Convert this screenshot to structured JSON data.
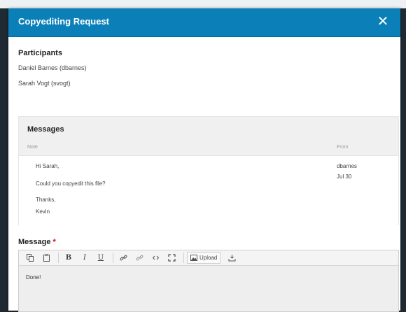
{
  "modal": {
    "title": "Copyediting Request",
    "close_icon": "close-icon"
  },
  "participants": {
    "title": "Participants",
    "items": [
      "Daniel Barnes (dbarnes)",
      "Sarah Vogt (svogt)"
    ]
  },
  "messages": {
    "title": "Messages",
    "columns": {
      "note": "Note",
      "from": "From"
    },
    "rows": [
      {
        "note_lines": [
          "Hi Sarah,",
          "Could you copyedit this file?",
          "Thanks,",
          "Kevin"
        ],
        "from_user": "dbarnes",
        "from_date": "Jul 30"
      }
    ]
  },
  "message_field": {
    "label": "Message",
    "required_mark": "*",
    "value": "Done!",
    "toolbar": {
      "copy_icon": "copy-icon",
      "paste_icon": "paste-icon",
      "bold": "B",
      "italic": "I",
      "underline": "U",
      "link_icon": "link-icon",
      "unlink_icon": "unlink-icon",
      "code_icon": "code-icon",
      "fullscreen_icon": "fullscreen-icon",
      "upload_label": "Upload",
      "upload_icon": "image-icon",
      "download_icon": "download-icon"
    }
  },
  "colors": {
    "header": "#0a7fb8",
    "required": "#d00000"
  }
}
